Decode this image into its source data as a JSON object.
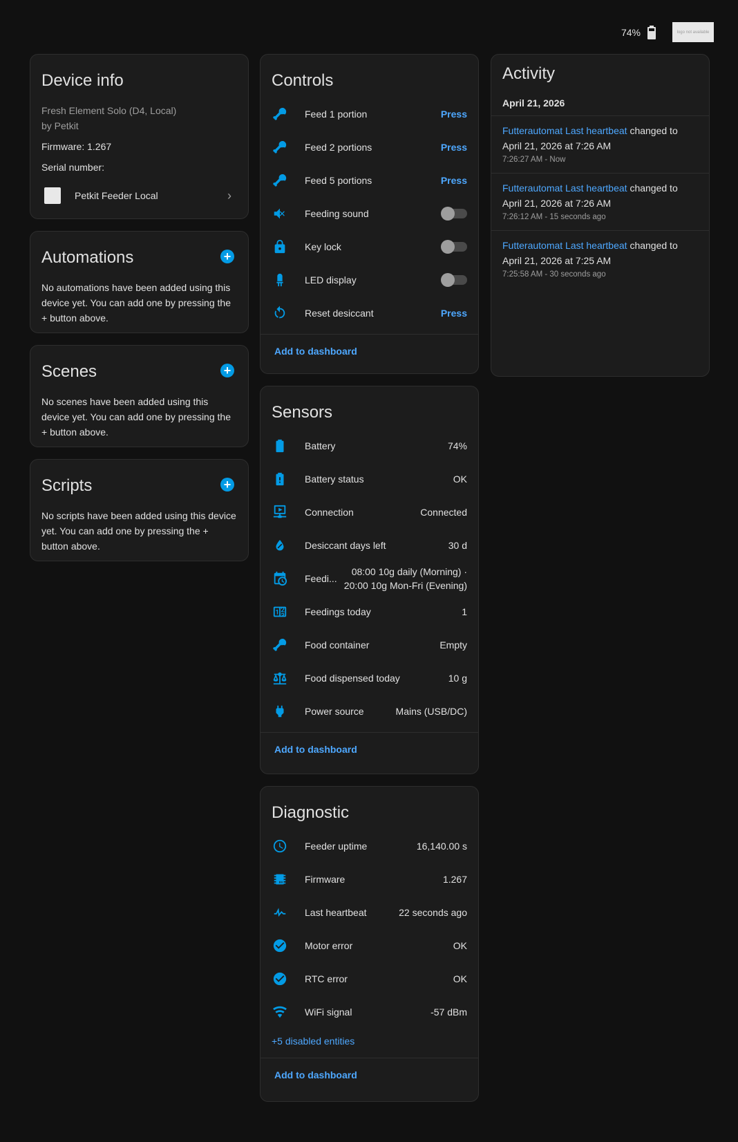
{
  "topbar": {
    "battery_pct": "74%",
    "logo_text": "logo not available"
  },
  "device_info": {
    "title": "Device info",
    "model": "Fresh Element Solo (D4, Local)",
    "by": "by Petkit",
    "firmware": "Firmware: 1.267",
    "serial": "Serial number:",
    "integration": "Petkit Feeder Local"
  },
  "automations": {
    "title": "Automations",
    "desc": "No automations have been added using this device yet. You can add one by pressing the + button above."
  },
  "scenes": {
    "title": "Scenes",
    "desc": "No scenes have been added using this device yet. You can add one by pressing the + button above."
  },
  "scripts": {
    "title": "Scripts",
    "desc": "No scripts have been added using this device yet. You can add one by pressing the + button above."
  },
  "controls": {
    "title": "Controls",
    "rows": [
      {
        "name": "Feed 1 portion",
        "action": "Press",
        "icon": "food-drumstick-icon"
      },
      {
        "name": "Feed 2 portions",
        "action": "Press",
        "icon": "food-drumstick-icon"
      },
      {
        "name": "Feed 5 portions",
        "action": "Press",
        "icon": "food-drumstick-icon"
      },
      {
        "name": "Feeding sound",
        "toggle": "off",
        "icon": "volume-off-icon"
      },
      {
        "name": "Key lock",
        "toggle": "off",
        "icon": "lock-icon"
      },
      {
        "name": "LED display",
        "toggle": "off",
        "icon": "led-icon"
      },
      {
        "name": "Reset desiccant",
        "action": "Press",
        "icon": "refresh-icon"
      }
    ],
    "footer": "Add to dashboard"
  },
  "sensors": {
    "title": "Sensors",
    "rows": [
      {
        "name": "Battery",
        "value": "74%",
        "icon": "battery-icon"
      },
      {
        "name": "Battery status",
        "value": "OK",
        "icon": "battery-alert-icon"
      },
      {
        "name": "Connection",
        "value": "Connected",
        "icon": "lan-connect-icon"
      },
      {
        "name": "Desiccant days left",
        "value": "30 d",
        "icon": "water-percent-icon"
      },
      {
        "name": "Feedi...",
        "value1": "08:00 10g daily (Morning) ·",
        "value2": "20:00 10g Mon-Fri (Evening)",
        "icon": "calendar-clock-icon"
      },
      {
        "name": "Feedings today",
        "value": "1",
        "icon": "counter-icon"
      },
      {
        "name": "Food container",
        "value": "Empty",
        "icon": "food-drumstick-icon"
      },
      {
        "name": "Food dispensed today",
        "value": "10 g",
        "icon": "scale-icon"
      },
      {
        "name": "Power source",
        "value": "Mains (USB/DC)",
        "icon": "power-plug-icon"
      }
    ],
    "footer": "Add to dashboard"
  },
  "diagnostic": {
    "title": "Diagnostic",
    "rows": [
      {
        "name": "Feeder uptime",
        "value": "16,140.00 s",
        "icon": "clock-icon"
      },
      {
        "name": "Firmware",
        "value": "1.267",
        "icon": "chip-icon"
      },
      {
        "name": "Last heartbeat",
        "value": "22 seconds ago",
        "icon": "heart-pulse-icon"
      },
      {
        "name": "Motor error",
        "value": "OK",
        "icon": "check-circle-icon"
      },
      {
        "name": "RTC error",
        "value": "OK",
        "icon": "check-circle-icon"
      },
      {
        "name": "WiFi signal",
        "value": "-57 dBm",
        "icon": "wifi-icon"
      }
    ],
    "disabled": "+5 disabled entities",
    "footer": "Add to dashboard"
  },
  "activity": {
    "title": "Activity",
    "date": "April 21, 2026",
    "entries": [
      {
        "entity": "Futterautomat Last heartbeat",
        "changed": " changed to",
        "value": "April 21, 2026 at 7:26 AM",
        "time": "7:26:27 AM - Now"
      },
      {
        "entity": "Futterautomat Last heartbeat",
        "changed": " changed to",
        "value": "April 21, 2026 at 7:26 AM",
        "time": "7:26:12 AM - 15 seconds ago"
      },
      {
        "entity": "Futterautomat Last heartbeat",
        "changed": " changed to",
        "value": "April 21, 2026 at 7:25 AM",
        "time": "7:25:58 AM - 30 seconds ago"
      }
    ]
  },
  "colors": {
    "accent": "#039be5",
    "link": "#4ea8ff",
    "card": "#1c1c1c",
    "background": "#111111"
  }
}
